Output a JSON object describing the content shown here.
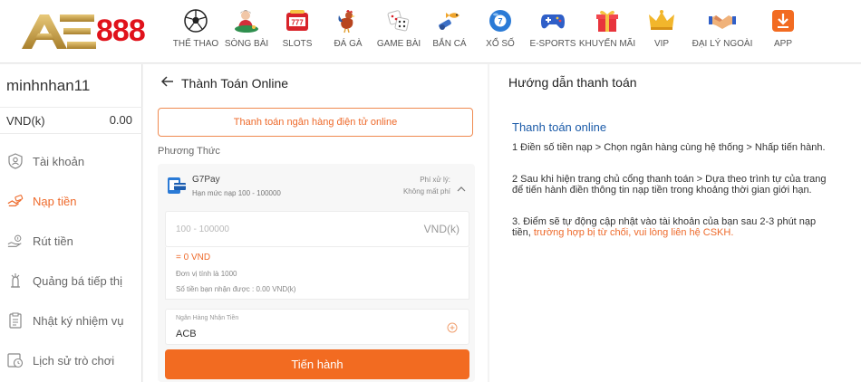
{
  "brand": {
    "logo_number": "888"
  },
  "nav": [
    {
      "label": "THỂ THAO",
      "icon": "soccer-ball-icon"
    },
    {
      "label": "SÒNG BÀI",
      "icon": "casino-dealer-icon"
    },
    {
      "label": "SLOTS",
      "icon": "slot-machine-icon"
    },
    {
      "label": "ĐÁ GÀ",
      "icon": "rooster-icon"
    },
    {
      "label": "GAME BÀI",
      "icon": "dice-icon"
    },
    {
      "label": "BẮN CÁ",
      "icon": "fish-shooting-icon"
    },
    {
      "label": "XỔ SỐ",
      "icon": "lottery-ball-icon"
    },
    {
      "label": "E-SPORTS",
      "icon": "gamepad-icon"
    },
    {
      "label": "KHUYẾN MÃI",
      "icon": "gift-icon"
    },
    {
      "label": "VIP",
      "icon": "crown-icon"
    },
    {
      "label": "ĐẠI LÝ NGOÀI",
      "icon": "handshake-icon"
    },
    {
      "label": "APP",
      "icon": "download-icon"
    }
  ],
  "sidebar": {
    "username": "minhnhan11",
    "currency": "VND(k)",
    "balance": "0.00",
    "items": [
      {
        "label": "Tài khoản",
        "icon": "account-shield-icon"
      },
      {
        "label": "Nạp tiền",
        "icon": "deposit-icon"
      },
      {
        "label": "Rút tiền",
        "icon": "withdraw-icon"
      },
      {
        "label": "Quảng bá tiếp thị",
        "icon": "promotion-icon"
      },
      {
        "label": "Nhật ký nhiệm vụ",
        "icon": "task-log-icon"
      },
      {
        "label": "Lịch sử trò chơi",
        "icon": "game-history-icon"
      }
    ]
  },
  "main": {
    "title": "Thành Toán Online",
    "method_button": "Thanh toán ngân hàng điện tử online",
    "method_label": "Phương Thức",
    "g7pay": {
      "name": "G7Pay",
      "limit": "Hạn mức nạp 100 - 100000",
      "fee_label": "Phí xử lý:",
      "fee_value": "Không mất phí"
    },
    "amount": {
      "placeholder": "100 - 100000",
      "unit": "VND(k)"
    },
    "calc": {
      "equals": "= 0 VND",
      "unit_note": "Đơn vị tính là 1000",
      "received": "Số tiền bạn nhận được : 0.00 VND(k)"
    },
    "bank": {
      "label": "Ngân Hàng Nhận Tiền",
      "value": "ACB"
    },
    "submit": "Tiến hành"
  },
  "guide": {
    "heading": "Hướng dẫn thanh toán",
    "subheading": "Thanh toán online",
    "step1": "1 Điền số tiền nạp > Chọn ngân hàng cùng hệ thống > Nhấp tiến hành.",
    "step2": "2 Sau khi hiện trang chủ cổng thanh toán > Dựa theo trình tự của trang để tiến hành điền thông tin nạp tiền trong khoảng thời gian giới hạn.",
    "step3_text": "3. Điểm sẽ tự động cập nhật vào tài khoản của bạn sau 2-3 phút nạp tiền, ",
    "step3_link": "trường hợp bị từ chối, vui lòng liên hệ CSKH."
  },
  "colors": {
    "accent": "#f26b21",
    "brand_red": "#e0121b",
    "brand_gold": "#c9a24a",
    "guide_blue": "#1a5aa8"
  }
}
